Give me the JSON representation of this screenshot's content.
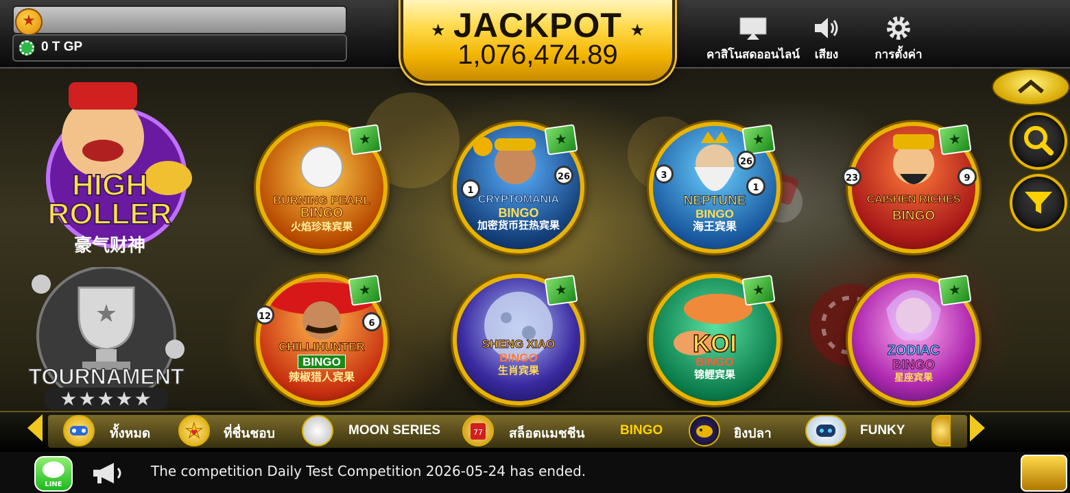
{
  "header": {
    "player_name": "",
    "credits": "0 T GP",
    "jackpot_title": "JACKPOT",
    "jackpot_value": "1,076,474.89",
    "nav": [
      {
        "label": "คาสิโนสดออนไลน์",
        "icon": "live-casino-icon"
      },
      {
        "label": "เสียง",
        "icon": "speaker-icon"
      },
      {
        "label": "การตั้งค่า",
        "icon": "gear-icon"
      }
    ]
  },
  "sidebar": {
    "high_roller": {
      "line1": "HIGH",
      "line2": "ROLLER",
      "subtitle": "豪气财神"
    },
    "tournament": {
      "label": "TOURNAMENT"
    }
  },
  "games": [
    {
      "title": "BURNING PEARL",
      "subtitle": "BINGO",
      "cn": "火焰珍珠宾果"
    },
    {
      "title": "CRYPTOMANIA",
      "subtitle": "BINGO",
      "cn": "加密货币狂热宾果"
    },
    {
      "title": "NEPTUNE",
      "subtitle": "BINGO",
      "cn": "海王宾果"
    },
    {
      "title": "CAISHEN RICHES",
      "subtitle": "BINGO",
      "cn": ""
    },
    {
      "title": "CHILLIHUNTER",
      "subtitle": "BINGO",
      "cn": "辣椒猎人宾果"
    },
    {
      "title": "SHENG XIAO",
      "subtitle": "BINGO",
      "cn": "生肖宾果"
    },
    {
      "title": "KOI",
      "subtitle": "BINGO",
      "cn": "锦鲤宾果"
    },
    {
      "title": "ZODIAC",
      "subtitle": "BINGO",
      "cn": "星座宾果"
    }
  ],
  "balls": {
    "crypto": [
      "26",
      "1"
    ],
    "neptune": [
      "3",
      "26",
      "1"
    ],
    "caishen": [
      "23",
      "9"
    ],
    "chilli": [
      "12",
      "6"
    ]
  },
  "categories": [
    {
      "label": "ทั้งหมด",
      "icon": "gamepad-icon"
    },
    {
      "label": "ที่ชื่นชอบ",
      "icon": "star-heart-icon"
    },
    {
      "label": "MOON SERIES",
      "icon": "moon-icon"
    },
    {
      "label": "สล็อตแมชชีน",
      "icon": "slot-machine-icon"
    },
    {
      "label": "BINGO",
      "icon": ""
    },
    {
      "label": "ยิงปลา",
      "icon": "fish-icon"
    },
    {
      "label": "FUNKY",
      "icon": "robot-icon"
    }
  ],
  "footer": {
    "line_label": "LINE",
    "announcement": "The competition Daily Test Competition 2026-05-24 has ended."
  },
  "colors": {
    "gold": "#e8b400",
    "category_active": "#ffd200",
    "badge_green": "#1a8a1a"
  }
}
